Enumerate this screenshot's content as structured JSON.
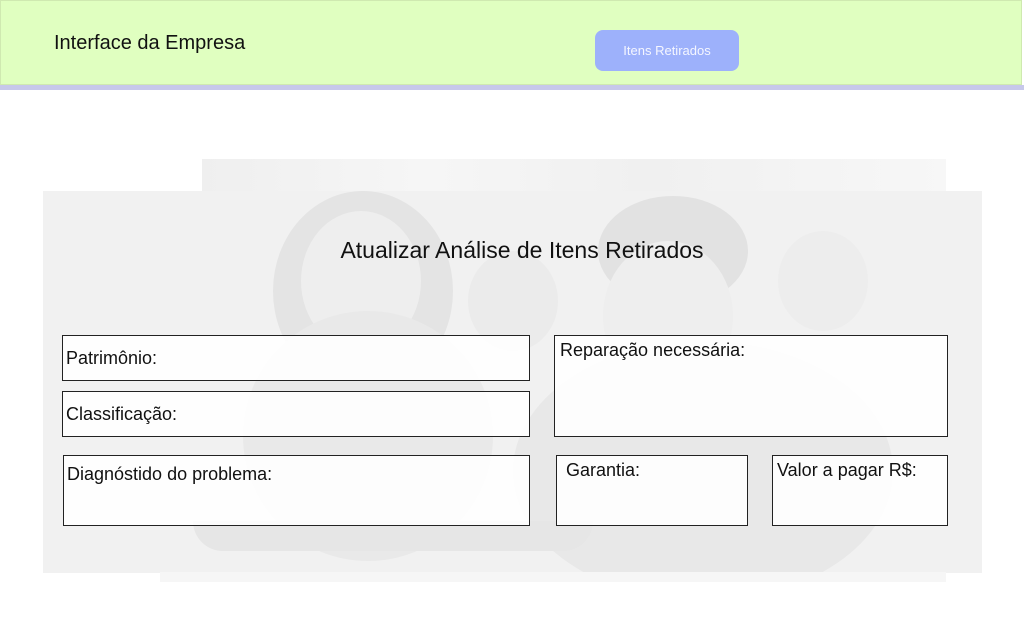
{
  "header": {
    "brand": "Interface da Empresa",
    "nav_button_label": "Itens Retirados"
  },
  "form": {
    "title": "Atualizar Análise de Itens Retirados",
    "fields": {
      "patrimonio": "Patrimônio:",
      "classificacao": "Classificação:",
      "diagnostico": "Diagnóstido do problema:",
      "reparacao": "Reparação necessária:",
      "garantia": "Garantia:",
      "valor": "Valor a pagar R$:"
    }
  },
  "colors": {
    "header_bg": "#e0ffc0",
    "header_rule": "#c7c8ea",
    "button_bg": "#9db1fb",
    "button_text": "#f4f6ff"
  }
}
